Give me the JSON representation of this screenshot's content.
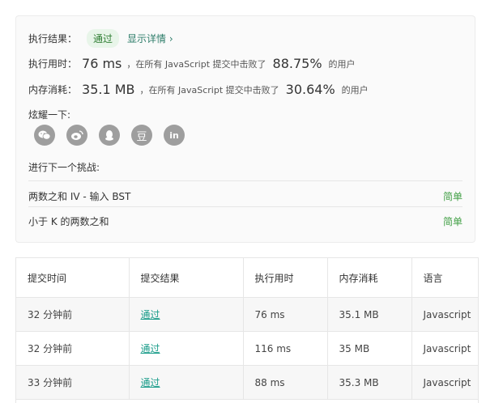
{
  "result": {
    "label": "执行结果：",
    "status": "通过",
    "details_link": "显示详情 ›"
  },
  "runtime": {
    "label": "执行用时：",
    "value": "76 ms",
    "text_before": "，在所有 JavaScript 提交中击败了",
    "percent": "88.75%",
    "text_after": "的用户"
  },
  "memory": {
    "label": "内存消耗：",
    "value": "35.1 MB",
    "text_before": "，在所有 JavaScript 提交中击败了",
    "percent": "30.64%",
    "text_after": "的用户"
  },
  "share": {
    "label": "炫耀一下:",
    "icons": [
      "wechat-icon",
      "weibo-icon",
      "qq-icon",
      "douban-icon",
      "linkedin-icon"
    ],
    "douban_glyph": "豆",
    "linkedin_glyph": "in"
  },
  "next": {
    "label": "进行下一个挑战:",
    "items": [
      {
        "title": "两数之和 IV - 输入 BST",
        "level": "简单"
      },
      {
        "title": "小于 K 的两数之和",
        "level": "简单"
      }
    ]
  },
  "table": {
    "headers": [
      "提交时间",
      "提交结果",
      "执行用时",
      "内存消耗",
      "语言"
    ],
    "rows": [
      {
        "time": "32 分钟前",
        "result": "通过",
        "runtime": "76 ms",
        "memory": "35.1 MB",
        "lang": "Javascript"
      },
      {
        "time": "32 分钟前",
        "result": "通过",
        "runtime": "116 ms",
        "memory": "35 MB",
        "lang": "Javascript"
      },
      {
        "time": "33 分钟前",
        "result": "通过",
        "runtime": "88 ms",
        "memory": "35.3 MB",
        "lang": "Javascript"
      }
    ]
  },
  "colors": {
    "pass_badge_bg": "#e8f5e9",
    "pass_text": "#1a9c8a",
    "easy": "#43a047",
    "icon_gray": "#9e9e9e"
  }
}
